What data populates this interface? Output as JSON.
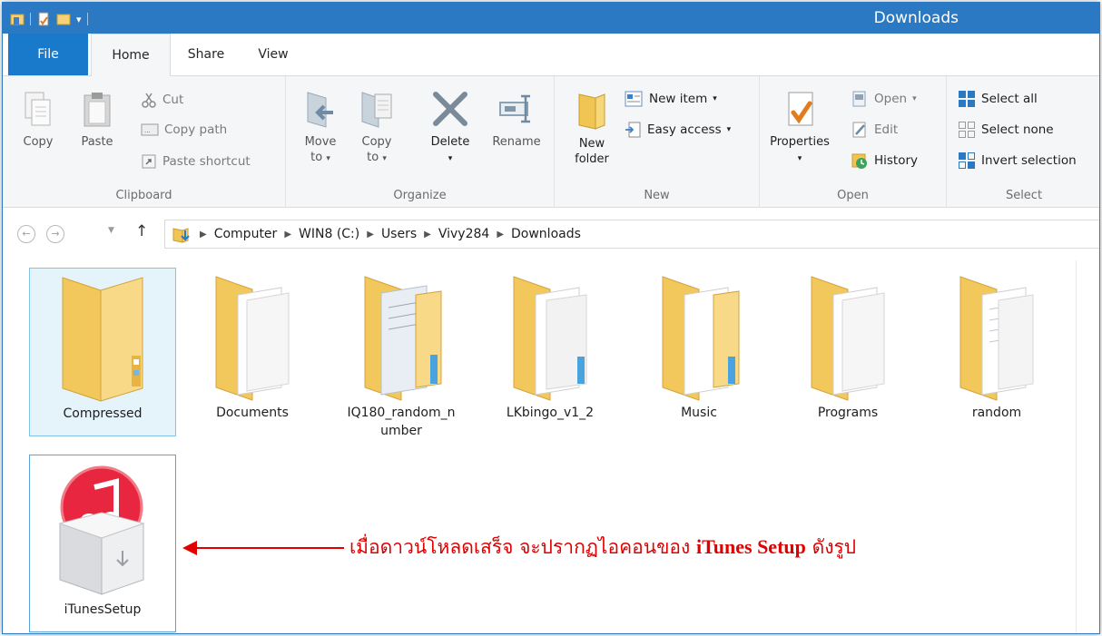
{
  "window": {
    "title": "Downloads",
    "accent": "#2b79c2",
    "file_tab_color": "#1979ca"
  },
  "tabs": [
    {
      "label": "File"
    },
    {
      "label": "Home"
    },
    {
      "label": "Share"
    },
    {
      "label": "View"
    }
  ],
  "ribbon": {
    "clipboard": {
      "label": "Clipboard",
      "copy": "Copy",
      "paste": "Paste",
      "cut": "Cut",
      "copy_path": "Copy path",
      "paste_shortcut": "Paste shortcut"
    },
    "organize": {
      "label": "Organize",
      "move_to_1": "Move",
      "move_to_2": "to",
      "copy_to_1": "Copy",
      "copy_to_2": "to",
      "delete": "Delete",
      "rename": "Rename"
    },
    "new": {
      "label": "New",
      "new_folder_1": "New",
      "new_folder_2": "folder",
      "new_item": "New item",
      "easy_access": "Easy access"
    },
    "open": {
      "label": "Open",
      "properties": "Properties",
      "open": "Open",
      "edit": "Edit",
      "history": "History"
    },
    "select": {
      "label": "Select",
      "select_all": "Select all",
      "select_none": "Select none",
      "invert_selection": "Invert selection"
    }
  },
  "address": {
    "crumbs": [
      "Computer",
      "WIN8 (C:)",
      "Users",
      "Vivy284",
      "Downloads"
    ]
  },
  "items": [
    {
      "label": "Compressed",
      "icon": "folder-zip-icon",
      "selected": true
    },
    {
      "label": "Documents",
      "icon": "folder-documents-icon"
    },
    {
      "label_1": "IQ180_random_n",
      "label_2": "umber",
      "icon": "folder-documents-icon"
    },
    {
      "label": "LKbingo_v1_2",
      "icon": "folder-documents-icon"
    },
    {
      "label": "Music",
      "icon": "folder-documents-icon"
    },
    {
      "label": "Programs",
      "icon": "folder-documents-icon"
    },
    {
      "label": "random",
      "icon": "folder-documents-icon"
    },
    {
      "label": "iTunesSetup",
      "icon": "itunes-setup-icon"
    }
  ],
  "annotation": {
    "text_before": "เมื่อดาวน์โหลดเสร็จ จะปรากฏไอคอนของ",
    "text_bold": "iTunes Setup",
    "text_after": "ดังรูป",
    "color": "#e00000"
  }
}
